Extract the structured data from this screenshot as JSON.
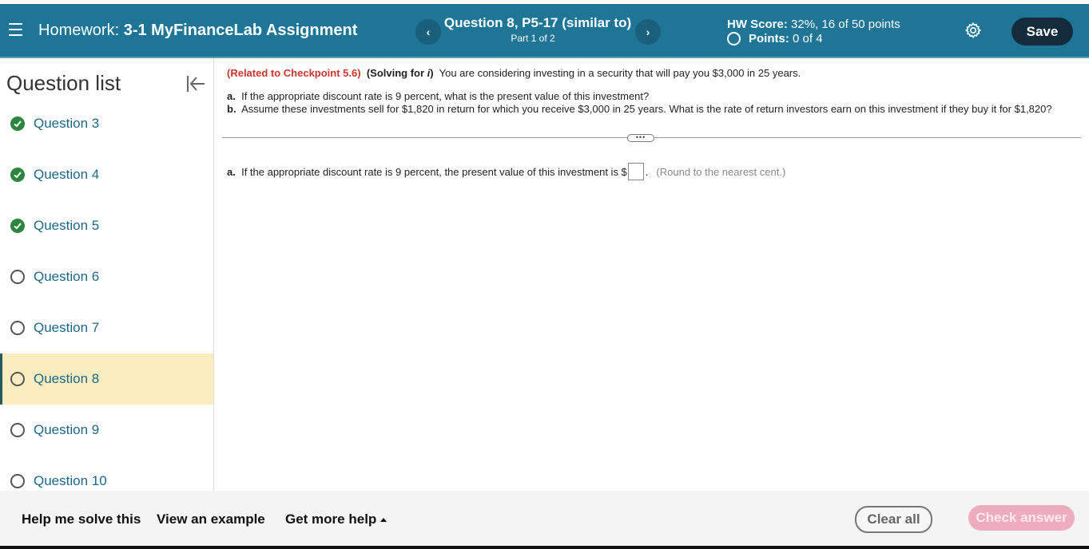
{
  "header": {
    "homework_prefix": "Homework:",
    "assignment_title": "3-1 MyFinanceLab Assignment",
    "question_title": "Question 8, P5-17 (similar to)",
    "part_label": "Part 1 of 2",
    "prev_icon": "chevron-left-icon",
    "next_icon": "chevron-right-icon",
    "hw_score_label": "HW Score:",
    "hw_score_value": "32%, 16 of 50 points",
    "points_label": "Points:",
    "points_value": "0 of 4",
    "settings_icon": "gear-icon",
    "save_label": "Save",
    "colors": {
      "header_bg": "#1f7596",
      "save_bg": "#142b3b"
    }
  },
  "sidebar": {
    "title": "Question list",
    "collapse_icon": "collapse-left-icon",
    "items": [
      {
        "label": "Question 3",
        "status": "complete"
      },
      {
        "label": "Question 4",
        "status": "complete"
      },
      {
        "label": "Question 5",
        "status": "complete"
      },
      {
        "label": "Question 6",
        "status": "incomplete"
      },
      {
        "label": "Question 7",
        "status": "incomplete"
      },
      {
        "label": "Question 8",
        "status": "incomplete",
        "active": true
      },
      {
        "label": "Question 9",
        "status": "incomplete"
      },
      {
        "label": "Question 10",
        "status": "incomplete"
      }
    ],
    "colors": {
      "complete": "#2e8540",
      "active_bg": "#fbecbf",
      "link": "#1c6887"
    }
  },
  "question": {
    "related": "(Related to Checkpoint 5.6)",
    "solving_prefix": "(Solving for ",
    "solving_var": "i",
    "solving_suffix": ")",
    "intro": "You are considering investing in a security that will pay you $3,000 in 25 years.",
    "part_a_letter": "a.",
    "part_a": "If the appropriate discount rate is 9 percent, what is the present value of this investment?",
    "part_b_letter": "b.",
    "part_b": "Assume these investments sell for $1,820 in return for which you receive $3,000 in 25 years.  What is the rate of return investors earn on this investment if they buy it for $1,820?",
    "expand_label": "•••",
    "answer_letter": "a.",
    "answer_text": "If the appropriate discount rate is 9 percent, the present value of this investment is $",
    "answer_value": "",
    "answer_after": ".",
    "answer_hint": "(Round to the nearest cent.)"
  },
  "footer": {
    "help_solve": "Help me solve this",
    "view_example": "View an example",
    "more_help": "Get more help",
    "clear_all": "Clear all",
    "check_answer": "Check answer"
  }
}
